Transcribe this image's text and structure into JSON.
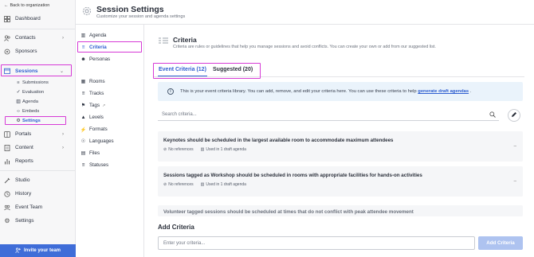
{
  "sidebar": {
    "back_label": "Back to organization",
    "items": [
      {
        "label": "Dashboard",
        "icon": "grid-icon"
      },
      {
        "label": "Contacts",
        "icon": "people-icon",
        "chevron": ">"
      },
      {
        "label": "Sponsors",
        "icon": "sponsor-icon"
      },
      {
        "label": "Sessions",
        "icon": "calendar-icon",
        "chevron": "v"
      },
      {
        "label": "Portals",
        "icon": "portal-icon",
        "chevron": ">"
      },
      {
        "label": "Content",
        "icon": "content-icon",
        "chevron": ">"
      },
      {
        "label": "Reports",
        "icon": "reports-icon"
      },
      {
        "label": "Studio",
        "icon": "studio-icon"
      },
      {
        "label": "History",
        "icon": "history-icon"
      },
      {
        "label": "Event Team",
        "icon": "team-icon"
      },
      {
        "label": "Settings",
        "icon": "gear-icon"
      }
    ],
    "session_subitems": [
      {
        "label": "Submissions"
      },
      {
        "label": "Evaluation"
      },
      {
        "label": "Agenda"
      },
      {
        "label": "Embeds"
      },
      {
        "label": "Settings"
      }
    ],
    "invite_label": "Invite your team"
  },
  "header": {
    "title": "Session Settings",
    "subtitle": "Customize your session and agenda settings"
  },
  "subnav": {
    "items": [
      {
        "label": "Agenda"
      },
      {
        "label": "Criteria"
      },
      {
        "label": "Personas"
      },
      {
        "label": "Rooms"
      },
      {
        "label": "Tracks"
      },
      {
        "label": "Tags"
      },
      {
        "label": "Levels"
      },
      {
        "label": "Formats"
      },
      {
        "label": "Languages"
      },
      {
        "label": "Files"
      },
      {
        "label": "Statuses"
      }
    ]
  },
  "main": {
    "title": "Criteria",
    "description": "Criteria are rules or guidelines that help you manage sessions and avoid conflicts. You can create your own or add from our suggested list.",
    "tabs": [
      {
        "label": "Event Criteria (12)",
        "active": true
      },
      {
        "label": "Suggested (20)",
        "active": false
      }
    ],
    "info_text": "This is your event criteria library. You can add, remove, and edit your criteria here. You can use these criteria to help",
    "info_link": "generate draft agendas",
    "info_end": ".",
    "search_placeholder": "Search criteria...",
    "criteria": [
      {
        "title": "Keynotes should be scheduled in the largest available room to accommodate maximum attendees",
        "references": "No references",
        "used": "Used in 1 draft agenda"
      },
      {
        "title": "Sessions tagged as Workshop should be scheduled in rooms with appropriate facilities for hands-on activities",
        "references": "No references",
        "used": "Used in 1 draft agenda"
      },
      {
        "title": "Volunteer tagged sessions should be scheduled at times that do not conflict with peak attendee movement"
      }
    ],
    "add_title": "Add Criteria",
    "add_placeholder": "Enter your criteria...",
    "add_button": "Add Criteria"
  },
  "colors": {
    "accent": "#2f5fd0",
    "highlight": "#d63ad6",
    "invite_bg": "#3f6dd8",
    "info_bg": "#eaf3fb",
    "card_bg": "#f5f6f8"
  }
}
